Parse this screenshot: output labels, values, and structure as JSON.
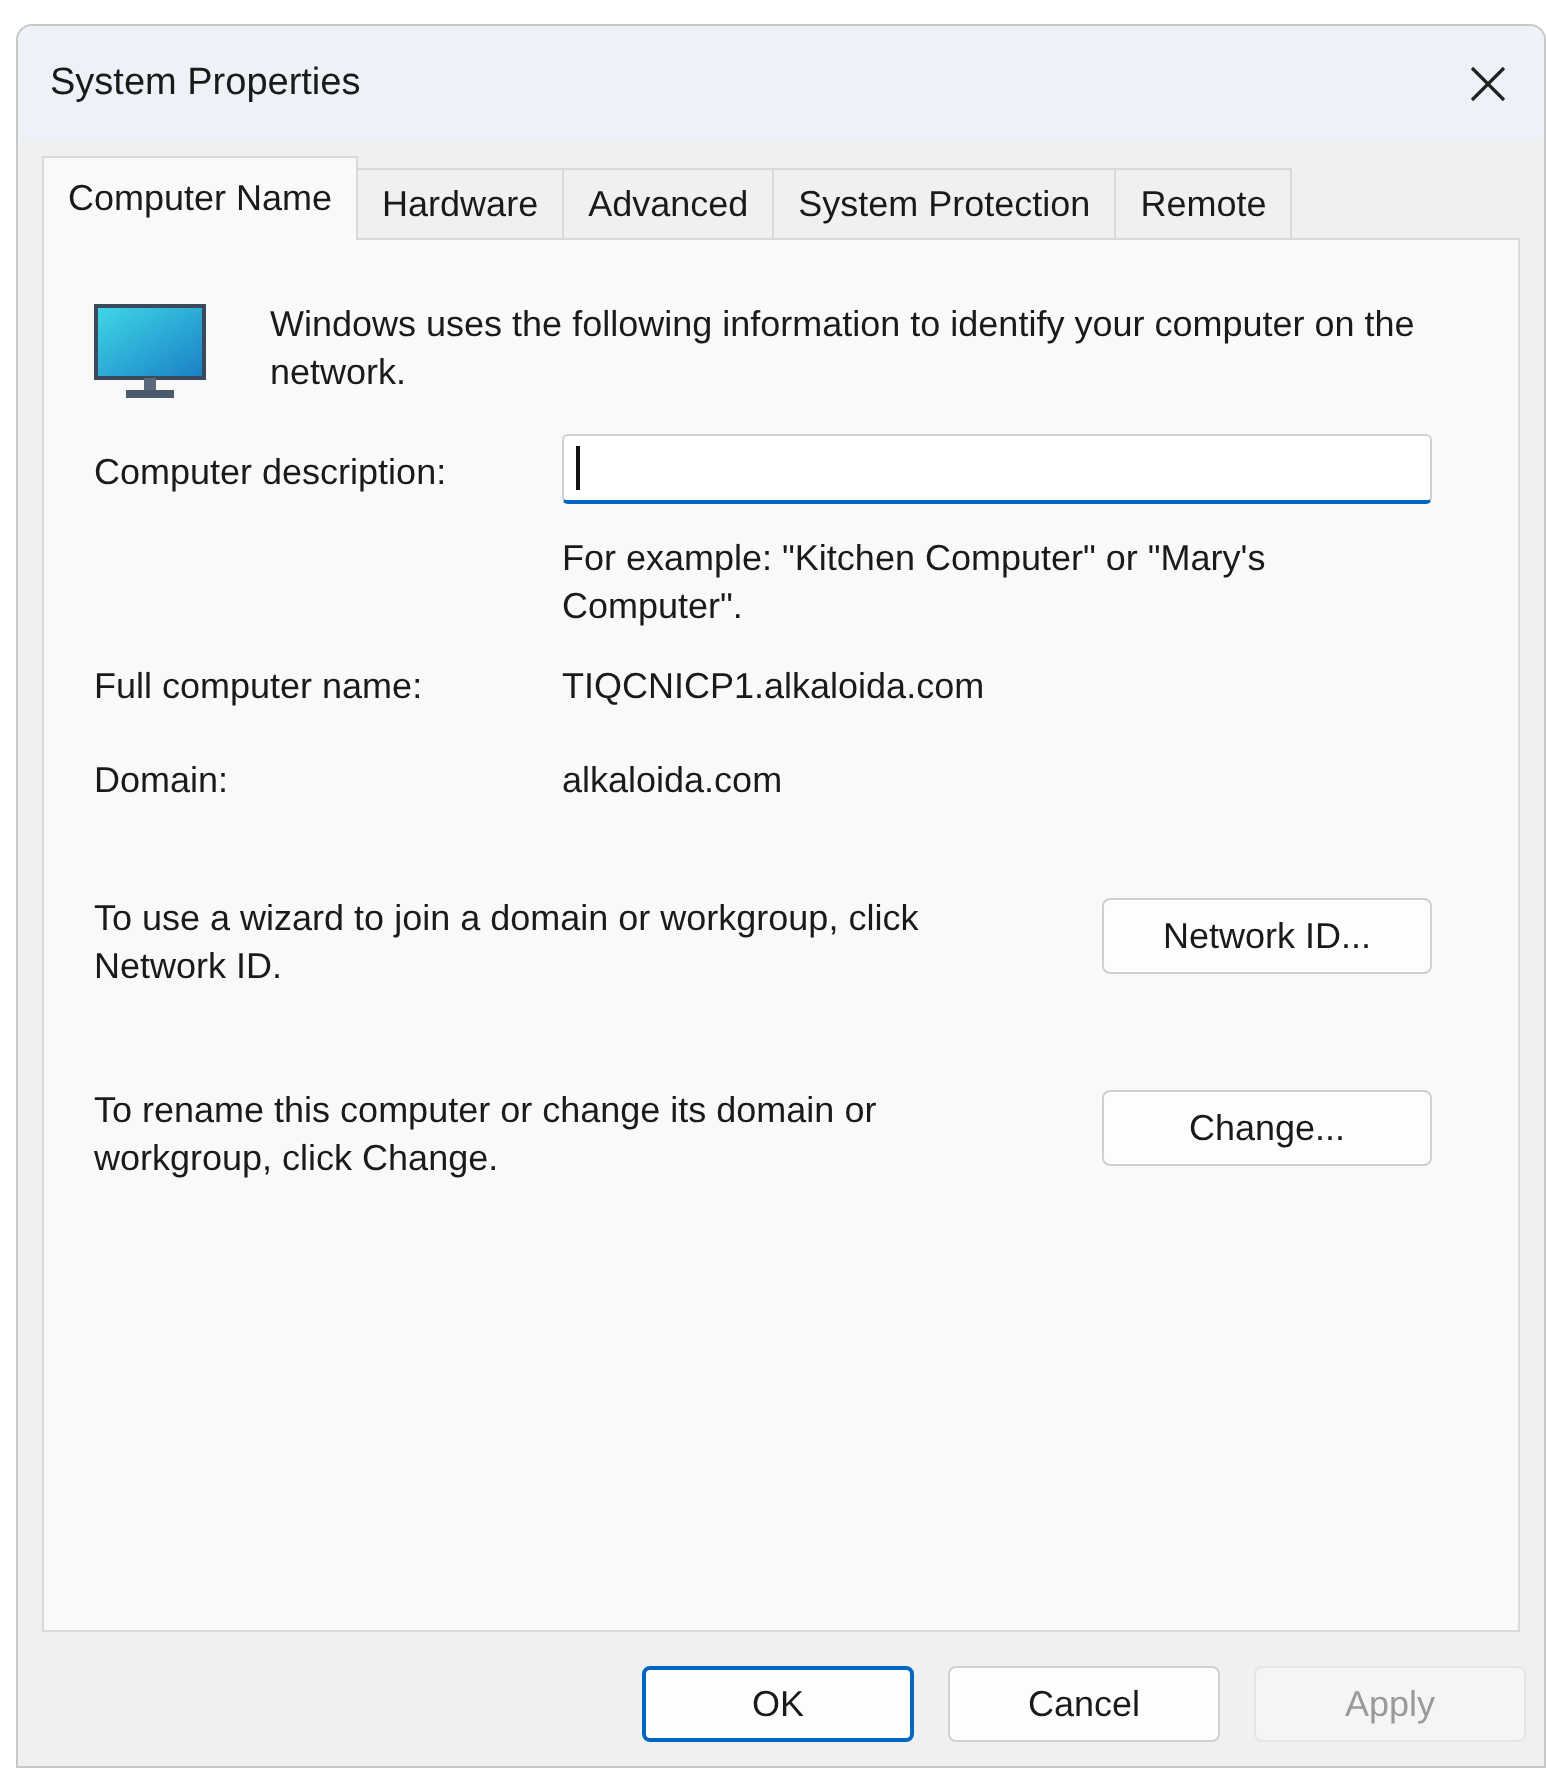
{
  "window": {
    "title": "System Properties"
  },
  "tabs": [
    {
      "label": "Computer Name",
      "selected": true
    },
    {
      "label": "Hardware",
      "selected": false
    },
    {
      "label": "Advanced",
      "selected": false
    },
    {
      "label": "System Protection",
      "selected": false
    },
    {
      "label": "Remote",
      "selected": false
    }
  ],
  "intro": "Windows uses the following information to identify your computer on the network.",
  "description": {
    "label": "Computer description:",
    "focused": true,
    "hint": "For example: \"Kitchen Computer\" or \"Mary's Computer\"."
  },
  "fields": [
    {
      "label": "Full computer name:",
      "value": "TIQCNICP1.alkaloida.com"
    },
    {
      "label": "Domain:",
      "value": "alkaloida.com"
    }
  ],
  "actions": [
    {
      "text": "To use a wizard to join a domain or workgroup, click Network ID.",
      "button": "Network ID..."
    },
    {
      "text": "To rename this computer or change its domain or workgroup, click Change.",
      "button": "Change..."
    }
  ],
  "buttons": [
    {
      "label": "OK",
      "default": true,
      "disabled": false
    },
    {
      "label": "Cancel",
      "default": false,
      "disabled": false
    },
    {
      "label": "Apply",
      "default": false,
      "disabled": true
    }
  ]
}
